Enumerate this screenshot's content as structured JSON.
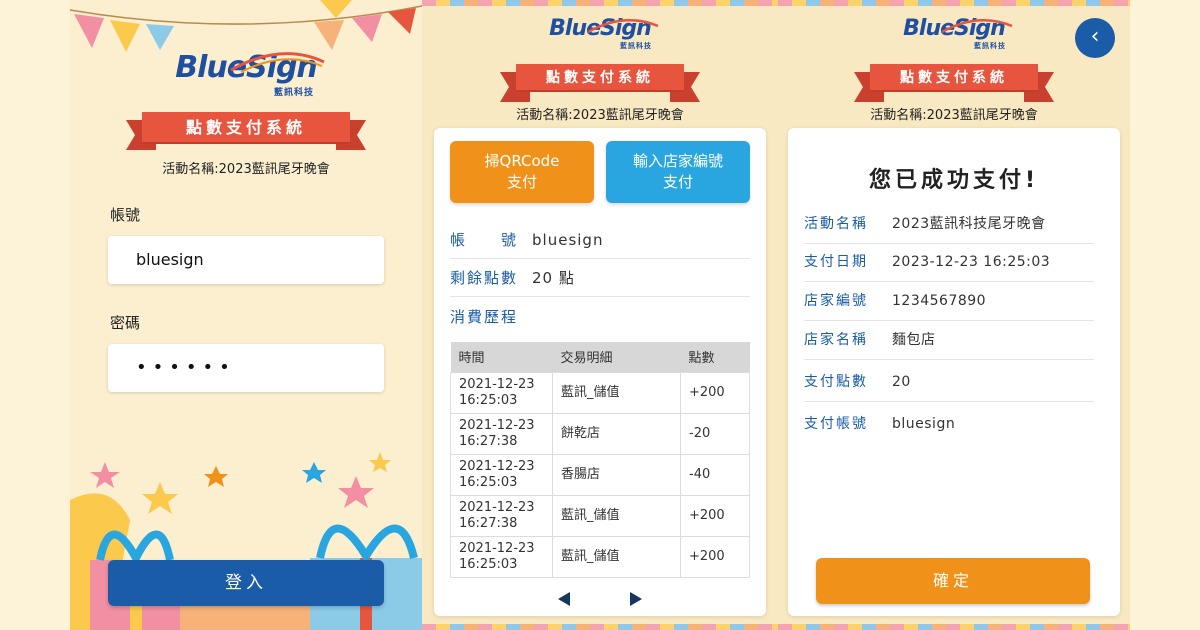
{
  "brand": {
    "word_blue": "BlueSign",
    "sub": "藍訊科技"
  },
  "system_title": "點數支付系統",
  "event_line": "活動名稱:2023藍訊尾牙晚會",
  "login": {
    "account_label": "帳號",
    "account_value": "bluesign",
    "password_label": "密碼",
    "password_value": "••••••",
    "login_button": "登入"
  },
  "account_page": {
    "scan_button_l1": "掃QRCode",
    "scan_button_l2": "支付",
    "store_button_l1": "輸入店家編號",
    "store_button_l2": "支付",
    "account_key": "帳　　號",
    "account_value": "bluesign",
    "points_key": "剩餘點數",
    "points_value": "20 點",
    "history_label": "消費歷程",
    "table": {
      "headers": [
        "時間",
        "交易明細",
        "點數"
      ],
      "rows": [
        {
          "time_l1": "2021-12-23",
          "time_l2": "16:25:03",
          "detail": "藍訊_儲值",
          "points": "+200"
        },
        {
          "time_l1": "2021-12-23",
          "time_l2": "16:27:38",
          "detail": "餅乾店",
          "points": "-20"
        },
        {
          "time_l1": "2021-12-23",
          "time_l2": "16:25:03",
          "detail": "香腸店",
          "points": "-40"
        },
        {
          "time_l1": "2021-12-23",
          "time_l2": "16:27:38",
          "detail": "藍訊_儲值",
          "points": "+200"
        },
        {
          "time_l1": "2021-12-23",
          "time_l2": "16:25:03",
          "detail": "藍訊_儲值",
          "points": "+200"
        }
      ]
    }
  },
  "success_page": {
    "title": "您已成功支付!",
    "rows": [
      {
        "k": "活動名稱",
        "v": "2023藍訊科技尾牙晚會"
      },
      {
        "k": "支付日期",
        "v": "2023-12-23 16:25:03"
      },
      {
        "k": "店家編號",
        "v": "1234567890"
      },
      {
        "k": "店家名稱",
        "v": "麵包店"
      },
      {
        "k": "支付點數",
        "v": "20"
      },
      {
        "k": "支付帳號",
        "v": "bluesign"
      }
    ],
    "confirm_button": "確定",
    "back_icon": "‹"
  },
  "colors": {
    "brand_blue": "#1b5ca8",
    "banner_red": "#e8553f",
    "orange": "#f0921a",
    "sky": "#29a6e0"
  }
}
